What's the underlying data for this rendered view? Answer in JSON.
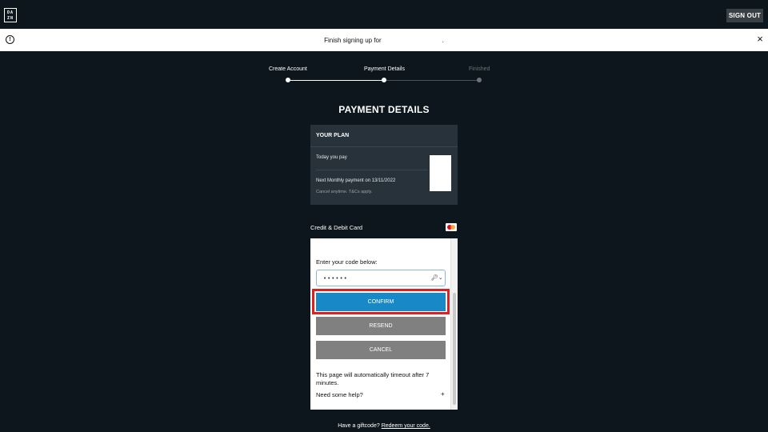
{
  "header": {
    "logo_lines": [
      "DA",
      "ZN"
    ],
    "sign_out_label": "SIGN OUT"
  },
  "banner": {
    "info_glyph": "!",
    "message": "Finish signing up for",
    "message_suffix": ".",
    "close_glyph": "×"
  },
  "steps": [
    {
      "label": "Create Account",
      "state": "done"
    },
    {
      "label": "Payment Details",
      "state": "current"
    },
    {
      "label": "Finished",
      "state": "pending"
    }
  ],
  "page_title": "PAYMENT DETAILS",
  "plan": {
    "heading": "YOUR PLAN",
    "today_label": "Today you pay",
    "next_payment_label": "Next Monthly payment on 13/11/2022",
    "terms_note": "Cancel anytime. T&Cs apply."
  },
  "payment_method": {
    "label": "Credit & Debit Card",
    "card_icon": "mastercard-icon"
  },
  "otp": {
    "prompt": "Enter your code below:",
    "code_value": "••••••",
    "key_glyph": "🔑︎⌄",
    "confirm_label": "CONFIRM",
    "resend_label": "RESEND",
    "cancel_label": "CANCEL",
    "timeout_text": "This page will automatically timeout after 7 minutes.",
    "help_label": "Need some help?",
    "help_toggle": "+"
  },
  "footer": {
    "giftcode_text": "Have a giftcode?",
    "redeem_link": "Redeem your code."
  },
  "colors": {
    "background": "#0c161c",
    "confirm": "#1889c6",
    "secondary_button": "#808080",
    "highlight": "#e02020"
  }
}
